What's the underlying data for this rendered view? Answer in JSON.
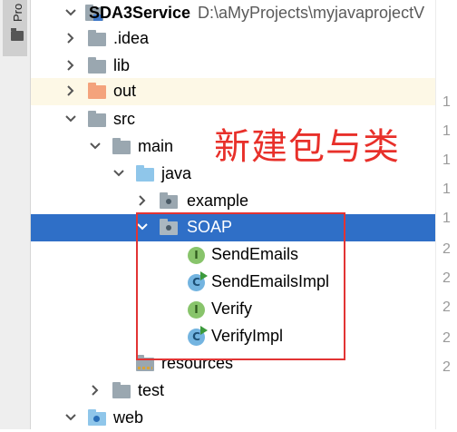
{
  "side_panel": {
    "tab_label": "Pro"
  },
  "tree": {
    "project": {
      "name": "SDA3Service",
      "path": "D:\\aMyProjects\\myjavaprojectV"
    },
    "items": [
      {
        "label": ".idea"
      },
      {
        "label": "lib"
      },
      {
        "label": "out"
      },
      {
        "label": "src"
      },
      {
        "label": "main"
      },
      {
        "label": "java"
      },
      {
        "label": "example"
      },
      {
        "label": "SOAP"
      },
      {
        "label": "SendEmails",
        "kind": "I"
      },
      {
        "label": "SendEmailsImpl",
        "kind": "C"
      },
      {
        "label": "Verify",
        "kind": "I"
      },
      {
        "label": "VerifyImpl",
        "kind": "C"
      },
      {
        "label": "resources"
      },
      {
        "label": "test"
      },
      {
        "label": "web"
      }
    ]
  },
  "gutter": {
    "numbers": [
      "1",
      "1",
      "1",
      "1",
      "1",
      "2",
      "2",
      "2",
      "2",
      "2"
    ]
  },
  "annotation": {
    "text": "新建包与类",
    "color": "#e8302a"
  },
  "colors": {
    "selection": "#2f6fc7",
    "highlight_row": "#fdf8e6"
  }
}
